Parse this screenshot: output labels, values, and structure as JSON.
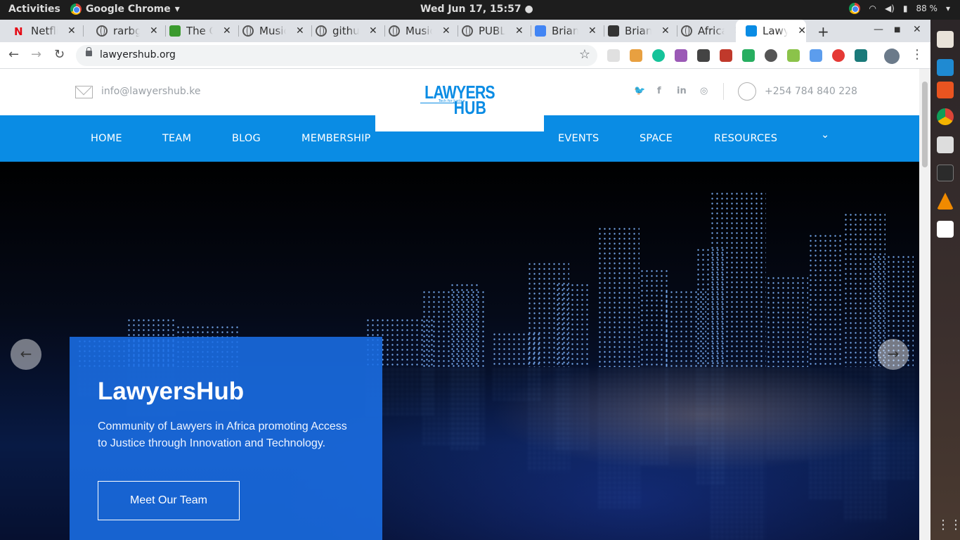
{
  "system": {
    "activities": "Activities",
    "app_name": "Google Chrome",
    "app_menu_icon": "▾",
    "clock": "Wed Jun 17, 15:57",
    "battery": "88 %"
  },
  "browser": {
    "tabs": [
      {
        "title": "Netflix",
        "favicon": "netflix-icon",
        "color": "#e50914"
      },
      {
        "title": "rarbg",
        "favicon": "globe-icon"
      },
      {
        "title": "The O",
        "favicon": "leaf-icon",
        "color": "#3b9a2e"
      },
      {
        "title": "Music",
        "favicon": "globe-icon"
      },
      {
        "title": "github",
        "favicon": "globe-icon"
      },
      {
        "title": "Music",
        "favicon": "globe-icon"
      },
      {
        "title": "PUBLI",
        "favicon": "globe-icon"
      },
      {
        "title": "Brian",
        "favicon": "docs-icon",
        "color": "#4285f4"
      },
      {
        "title": "Brian",
        "favicon": "dark-icon"
      },
      {
        "title": "Africa",
        "favicon": "globe-icon"
      },
      {
        "title": "Lawye",
        "favicon": "lawyershub-icon",
        "color": "#0a8ce4"
      }
    ],
    "new_tab": "+",
    "url": "lawyershub.org"
  },
  "site": {
    "email": "info@lawyershub.ke",
    "phone": "+254 784 840 228",
    "social": [
      "twitter-icon",
      "facebook-icon",
      "linkedin-icon",
      "instagram-icon"
    ],
    "social_glyphs": [
      "🐦",
      "f",
      "in",
      "◎"
    ],
    "logo_line1": "LAWYERS",
    "logo_line2": "HUB",
    "logo_tagline": "Tech for Justice",
    "nav": [
      "HOME",
      "TEAM",
      "BLOG",
      "MEMBERSHIP",
      "EVENTS",
      "SPACE",
      "RESOURCES"
    ],
    "nav_more": "⌄",
    "hero": {
      "title": "LawyersHub",
      "text": "Community of Lawyers in Africa promoting Access to Justice through Innovation and Technology.",
      "button": "Meet Our Team"
    },
    "brand_color": "#0a8ce4"
  }
}
